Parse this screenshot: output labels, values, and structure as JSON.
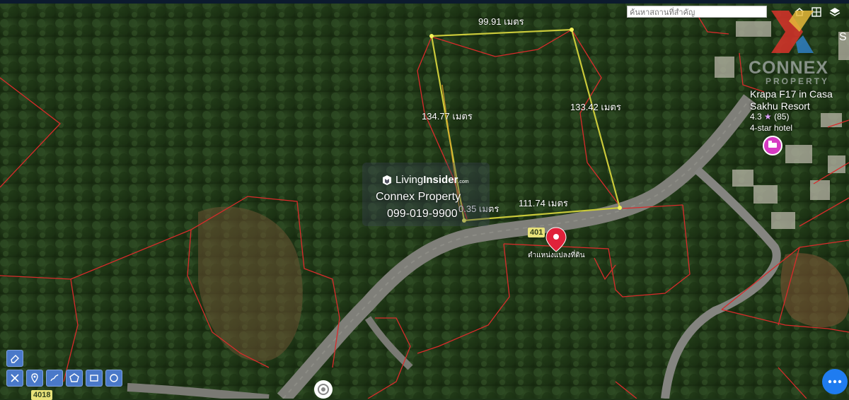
{
  "search": {
    "placeholder": "ค้นหาสถานที่สำคัญ"
  },
  "measurements": {
    "top": "99.91 เมตร",
    "left": "134.77 เมตร",
    "right": "133.42 เมตร",
    "bottom": "111.74 เมตร",
    "partial": "0.35 เมตร"
  },
  "watermark": {
    "brand_light": "Living",
    "brand_bold": "Insider",
    "brand_suffix": ".com",
    "company": "Connex Property",
    "phone": "099-019-9900"
  },
  "logo": {
    "name": "CONNEX",
    "sub": "PROPERTY"
  },
  "poi": {
    "name": "Krapa F17 in Casa Sakhu Resort",
    "rating": "4.3",
    "star": "★",
    "reviews": "(85)",
    "category": "4-star hotel",
    "color": "#d63ac2"
  },
  "map_labels": {
    "corner": "S"
  },
  "roads": {
    "route_top": "401",
    "route_bottom": "4018"
  },
  "pin": {
    "label": "ตำแหน่งแปลงที่ดิน",
    "color": "#e0223a"
  },
  "colors": {
    "boundary": "#d92b2b",
    "plot": "#c9c93a",
    "tool": "#4a79c9",
    "fab": "#1f7cf0"
  },
  "tools": [
    "eraser-icon",
    "ruler-icon",
    "pin-icon",
    "freehand-icon",
    "polygon-icon",
    "rectangle-icon",
    "circle-icon"
  ]
}
